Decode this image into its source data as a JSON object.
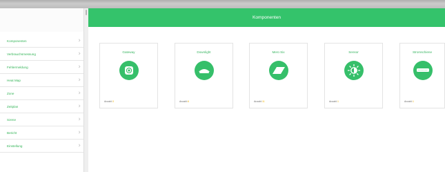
{
  "header": {
    "title": "Komponenten"
  },
  "sidebar": {
    "items": [
      {
        "label": "Komponenten"
      },
      {
        "label": "Verbrauchsmessung"
      },
      {
        "label": "Fehlermeldung"
      },
      {
        "label": "Heat Map"
      },
      {
        "label": "Zone"
      },
      {
        "label": "Zeitplan"
      },
      {
        "label": "Szene"
      },
      {
        "label": "Bericht"
      },
      {
        "label": "Einstellung"
      }
    ]
  },
  "cards": [
    {
      "title": "Gateway",
      "count_label": "Anzahl:",
      "count": "3",
      "icon": "gateway-icon"
    },
    {
      "title": "Downlight",
      "count_label": "Anzahl:",
      "count": "6",
      "icon": "downlight-icon"
    },
    {
      "title": "Mero Six",
      "count_label": "Anzahl:",
      "count": "11",
      "icon": "panel-light-icon"
    },
    {
      "title": "Sensor",
      "count_label": "Anzahl:",
      "count": "1",
      "icon": "sensor-icon"
    },
    {
      "title": "Stromschiene",
      "count_label": "Anzahl:",
      "count": "1",
      "icon": "track-rail-icon"
    }
  ],
  "colors": {
    "accent": "#34c36b",
    "link": "#33b457",
    "count": "#f2b400"
  }
}
